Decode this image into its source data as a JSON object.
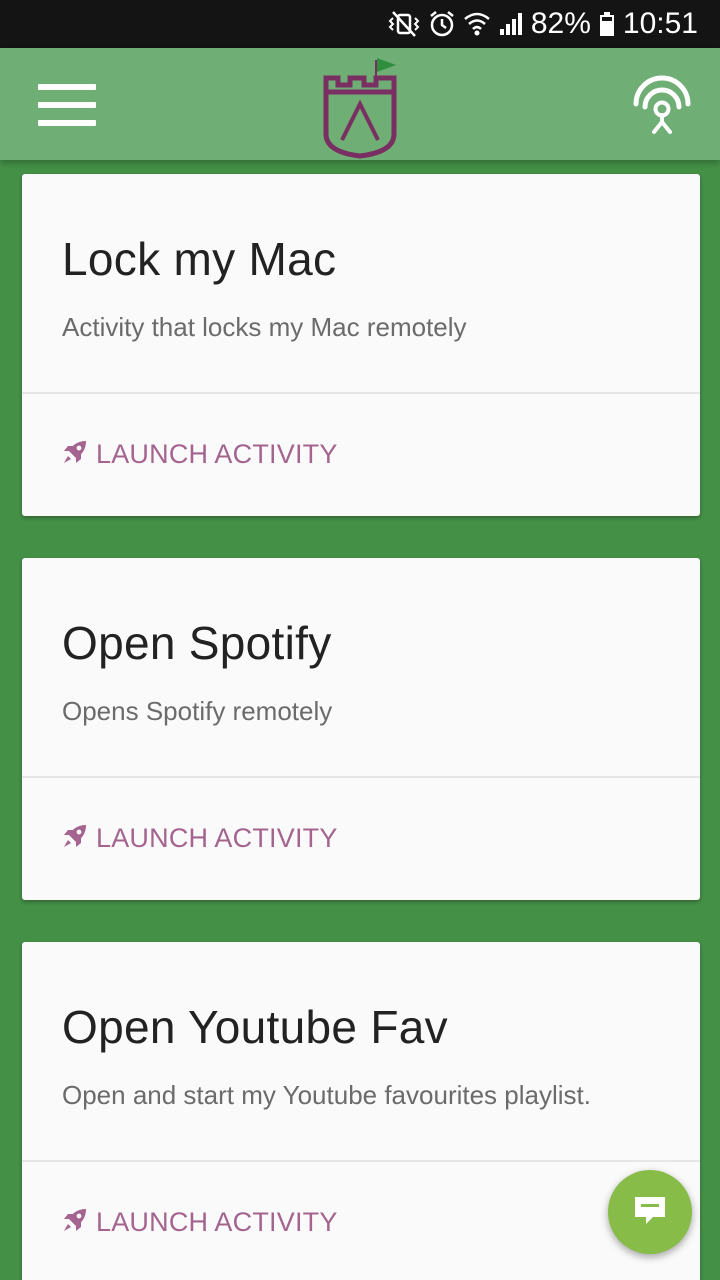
{
  "status_bar": {
    "battery": "82%",
    "time": "10:51",
    "icons": [
      "vibrate-mute-icon",
      "alarm-icon",
      "wifi-icon",
      "signal-icon",
      "battery-icon"
    ]
  },
  "app_bar": {
    "menu_icon": "hamburger-menu-icon",
    "logo_icon": "castle-shield-logo",
    "action_icon": "broadcast-antenna-icon",
    "color": "#6fae75"
  },
  "activities": [
    {
      "title": "Lock my Mac",
      "description": "Activity that locks my Mac remotely",
      "action_label": "LAUNCH ACTIVITY"
    },
    {
      "title": "Open Spotify",
      "description": "Opens Spotify remotely",
      "action_label": "LAUNCH ACTIVITY"
    },
    {
      "title": "Open Youtube Fav",
      "description": "Open and start my Youtube favourites playlist.",
      "action_label": "LAUNCH ACTIVITY"
    }
  ],
  "fab": {
    "icon": "chat-bubble-icon",
    "color": "#86bc47"
  },
  "colors": {
    "background": "#459047",
    "accent": "#a4648f",
    "logo": "#7a2f63"
  }
}
